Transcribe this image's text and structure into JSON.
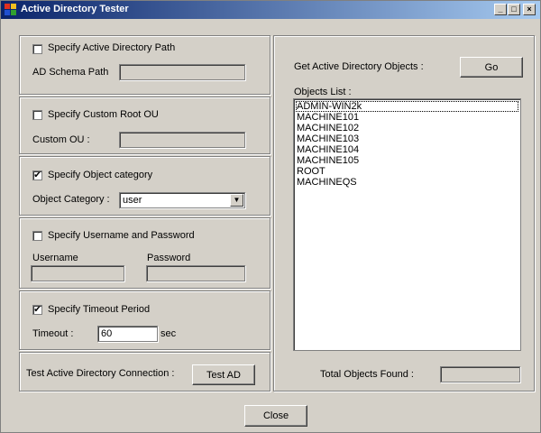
{
  "window": {
    "title": "Active Directory Tester",
    "min_label": "_",
    "max_label": "□",
    "close_label": "×"
  },
  "ad_path": {
    "checkbox_label": "Specify Active Directory Path",
    "checked": false,
    "field_label": "AD Schema Path",
    "value": ""
  },
  "root_ou": {
    "checkbox_label": "Specify Custom Root OU",
    "checked": false,
    "field_label": "Custom OU :",
    "value": ""
  },
  "object_category": {
    "checkbox_label": "Specify Object category",
    "checked": true,
    "field_label": "Object Category :",
    "selected": "user"
  },
  "credentials": {
    "checkbox_label": "Specify Username and Password",
    "checked": false,
    "username_label": "Username",
    "password_label": "Password",
    "username": "",
    "password": ""
  },
  "timeout": {
    "checkbox_label": "Specify Timeout Period",
    "checked": true,
    "field_label": "Timeout :",
    "value": "60",
    "unit": "sec"
  },
  "test": {
    "label": "Test Active Directory Connection :",
    "button": "Test AD"
  },
  "objects": {
    "get_label": "Get Active Directory Objects :",
    "go_button": "Go",
    "list_label": "Objects List :",
    "items": [
      "ADMIN-WIN2k",
      "MACHINE101",
      "MACHINE102",
      "MACHINE103",
      "MACHINE104",
      "MACHINE105",
      "ROOT",
      "MACHINEQS"
    ],
    "total_label": "Total Objects Found :",
    "total_value": ""
  },
  "footer": {
    "close_button": "Close"
  },
  "check_mark": "✔",
  "colors": {
    "titlebar_start": "#0a246a",
    "titlebar_end": "#a6caf0",
    "face": "#d4d0c8"
  }
}
